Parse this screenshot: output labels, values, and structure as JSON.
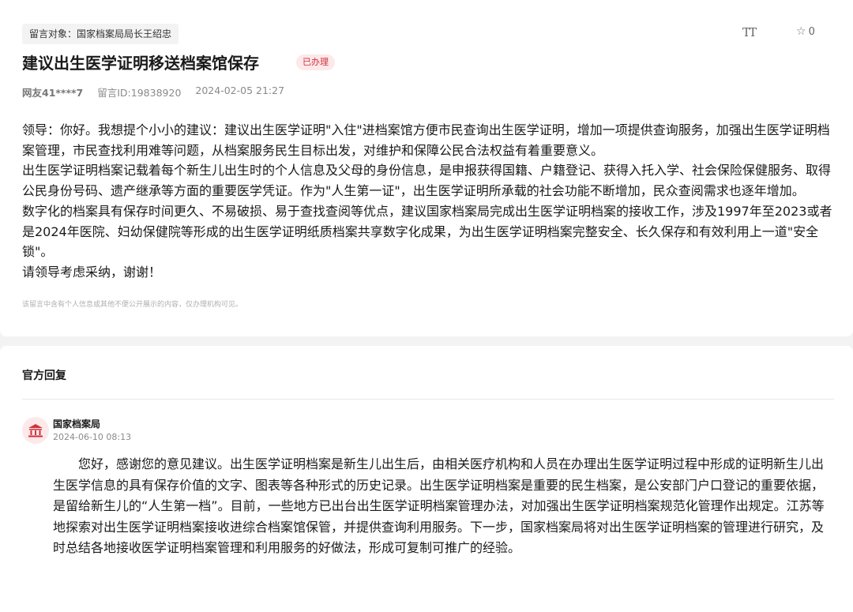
{
  "message": {
    "recipient": "留言对象：国家档案局局长王绍忠",
    "title": "建议出生医学证明移送档案馆保存",
    "status": "已办理",
    "user": "网友41****7",
    "message_id": "留言ID:19838920",
    "datetime": "2024-02-05 21:27",
    "paragraphs": [
      "领导：你好。我想提个小小的建议：建议出生医学证明\"入住\"进档案馆方便市民查询出生医学证明，增加一项提供查询服务，加强出生医学证明档案管理，市民查找利用难等问题，从档案服务民生目标出发，对维护和保障公民合法权益有着重要意义。",
      "出生医学证明档案记载着每个新生儿出生时的个人信息及父母的身份信息，是申报获得国籍、户籍登记、获得入托入学、社会保险保健服务、取得公民身份号码、遗产继承等方面的重要医学凭证。作为\"人生第一证\"，出生医学证明所承载的社会功能不断增加，民众查阅需求也逐年增加。",
      "数字化的档案具有保存时间更久、不易破损、易于查找查阅等优点，建议国家档案局完成出生医学证明档案的接收工作，涉及1997年至2023或者是2024年医院、妇幼保健院等形成的出生医学证明纸质档案共享数字化成果，为出生医学证明档案完整安全、长久保存和有效利用上一道\"安全锁\"。",
      "请领导考虑采纳，谢谢！"
    ],
    "privacy_notice": "该留言中含有个人信息或其他不便公开展示的内容，仅办理机构可见。"
  },
  "toolbar": {
    "font_size_label": "TT",
    "favorite_count": "0",
    "icons": [
      "font-size-icon",
      "star-outline-icon"
    ]
  },
  "reply": {
    "heading": "官方回复",
    "org": "国家档案局",
    "date": "2024-06-10 08:13",
    "text": "您好，感谢您的意见建议。出生医学证明档案是新生儿出生后，由相关医疗机构和人员在办理出生医学证明过程中形成的证明新生儿出生医学信息的具有保存价值的文字、图表等各种形式的历史记录。出生医学证明档案是重要的民生档案，是公安部门户口登记的重要依据，是留给新生儿的“人生第一档”。目前，一些地方已出台出生医学证明档案管理办法，对加强出生医学证明档案规范化管理作出规定。江苏等地探索对出生医学证明档案接收进综合档案馆保管，并提供查询利用服务。下一步，国家档案局将对出生医学证明档案的管理进行研究，及时总结各地接收医学证明档案管理和利用服务的好做法，形成可复制可推广的经验。",
    "avatar_icon": "government-building-icon"
  },
  "colors": {
    "accent_red": "#d0323c",
    "badge_bg": "#fde8ea",
    "page_bg": "#f3f3f3"
  }
}
